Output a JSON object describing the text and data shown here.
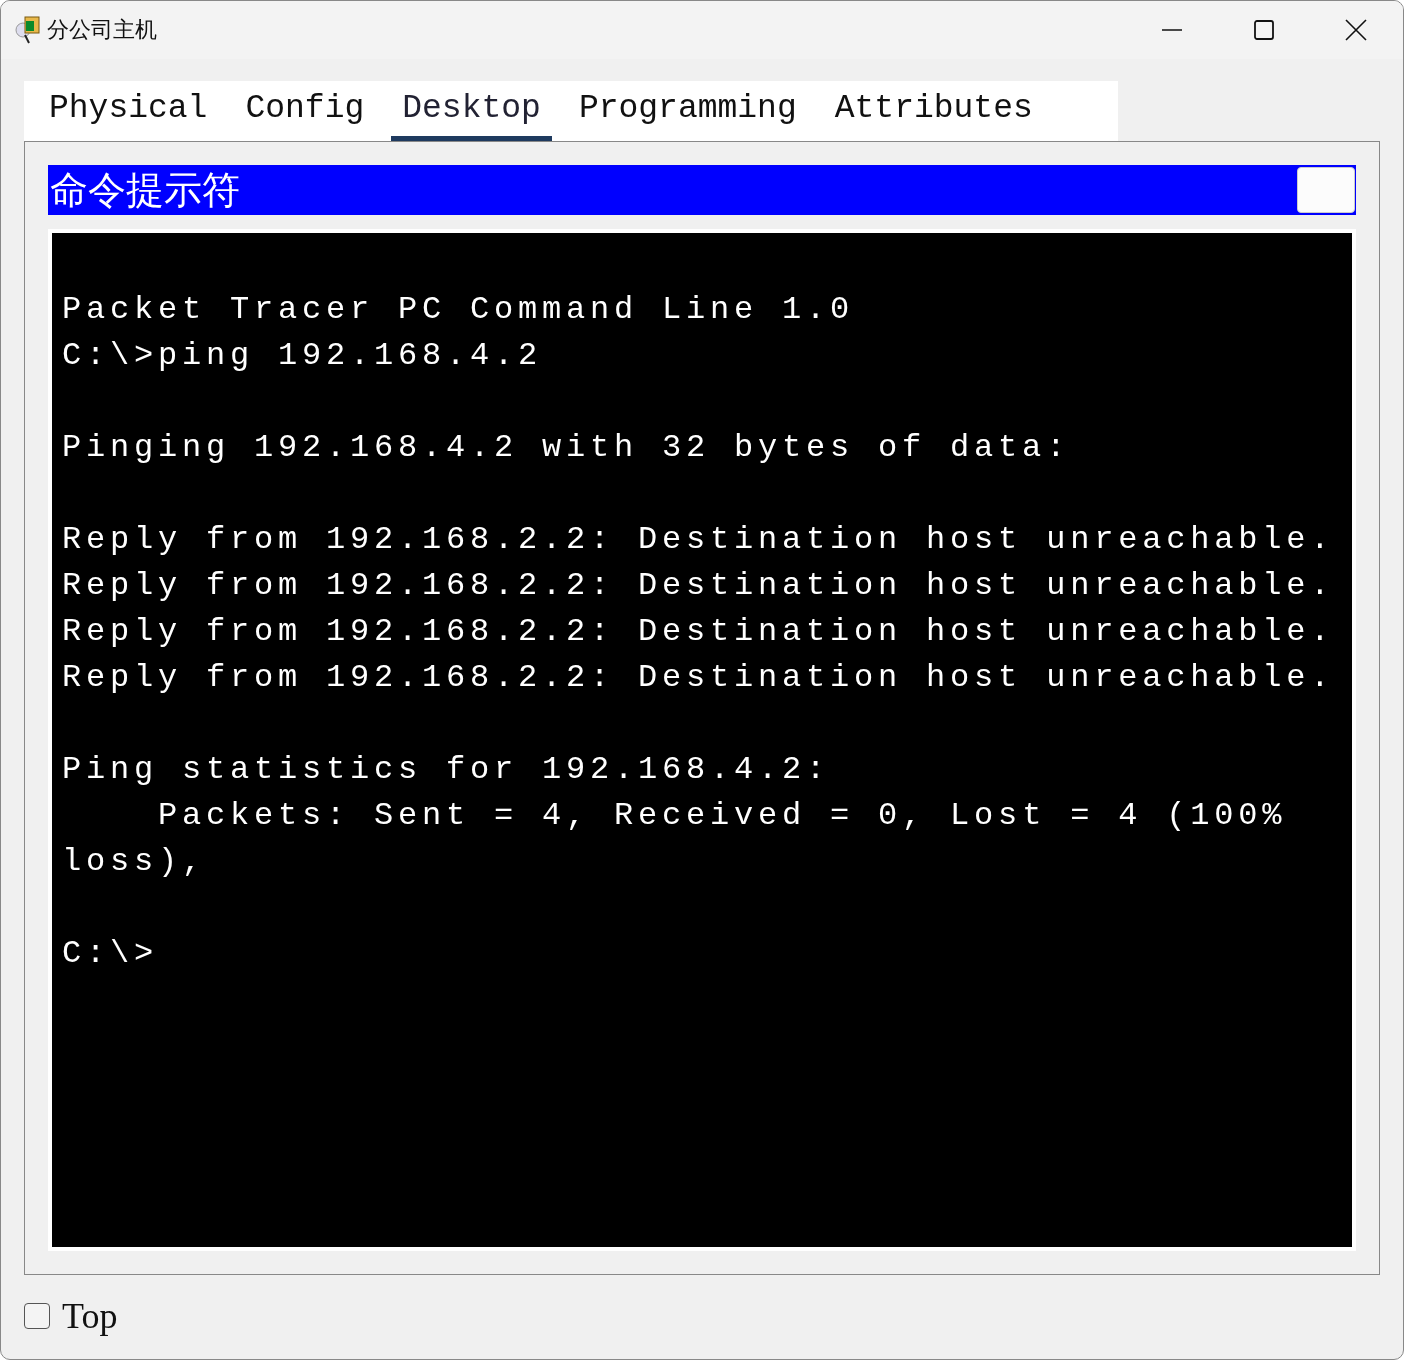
{
  "window": {
    "title": "分公司主机"
  },
  "tabs": [
    {
      "label": "Physical",
      "selected": false
    },
    {
      "label": "Config",
      "selected": false
    },
    {
      "label": "Desktop",
      "selected": true
    },
    {
      "label": "Programming",
      "selected": false
    },
    {
      "label": "Attributes",
      "selected": false
    }
  ],
  "panel": {
    "title": "命令提示符"
  },
  "terminal": {
    "blocks": [
      [
        "Packet Tracer PC Command Line 1.0",
        "C:\\>ping 192.168.4.2"
      ],
      [
        "Pinging 192.168.4.2 with 32 bytes of data:"
      ],
      [
        "Reply from 192.168.2.2: Destination host unreachable.",
        "Reply from 192.168.2.2: Destination host unreachable.",
        "Reply from 192.168.2.2: Destination host unreachable.",
        "Reply from 192.168.2.2: Destination host unreachable."
      ],
      [
        "Ping statistics for 192.168.4.2:",
        "    Packets: Sent = 4, Received = 0, Lost = 4 (100% loss),"
      ],
      [
        "C:\\>"
      ]
    ]
  },
  "top_checkbox": {
    "label": "Top",
    "checked": false
  }
}
